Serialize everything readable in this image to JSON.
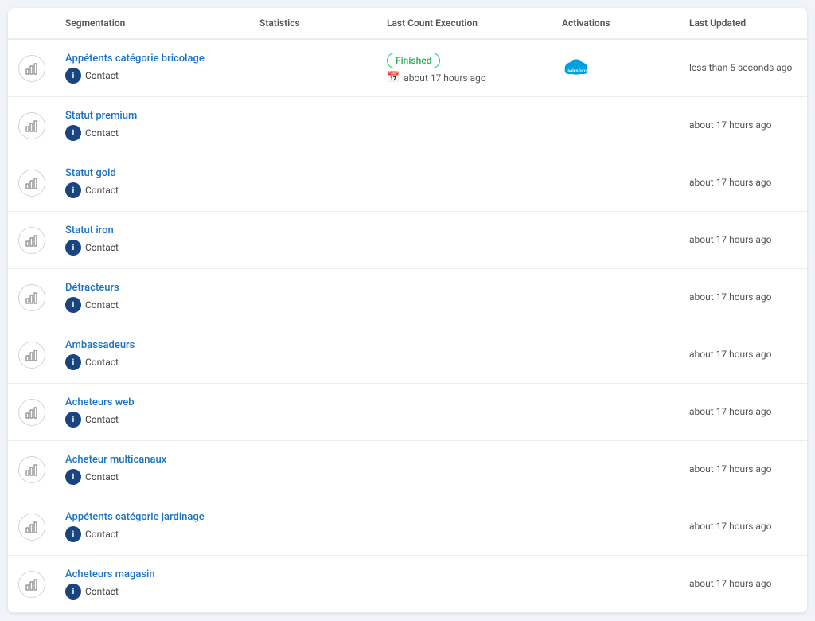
{
  "header": {
    "cols": [
      {
        "key": "icon",
        "label": ""
      },
      {
        "key": "segmentation",
        "label": "Segmentation"
      },
      {
        "key": "statistics",
        "label": "Statistics"
      },
      {
        "key": "last_count",
        "label": "Last Count Execution"
      },
      {
        "key": "activations",
        "label": "Activations"
      },
      {
        "key": "last_updated",
        "label": "Last Updated"
      }
    ]
  },
  "rows": [
    {
      "id": "1",
      "name": "Appétents catégorie bricolage",
      "type": "Contact",
      "status": "Finished",
      "last_count": "about 17 hours ago",
      "has_salesforce": true,
      "last_updated": "less than 5 seconds ago"
    },
    {
      "id": "2",
      "name": "Statut premium",
      "type": "Contact",
      "status": "",
      "last_count": "",
      "has_salesforce": false,
      "last_updated": "about 17 hours ago"
    },
    {
      "id": "3",
      "name": "Statut gold",
      "type": "Contact",
      "status": "",
      "last_count": "",
      "has_salesforce": false,
      "last_updated": "about 17 hours ago"
    },
    {
      "id": "4",
      "name": "Statut iron",
      "type": "Contact",
      "status": "",
      "last_count": "",
      "has_salesforce": false,
      "last_updated": "about 17 hours ago"
    },
    {
      "id": "5",
      "name": "Détracteurs",
      "type": "Contact",
      "status": "",
      "last_count": "",
      "has_salesforce": false,
      "last_updated": "about 17 hours ago"
    },
    {
      "id": "6",
      "name": "Ambassadeurs",
      "type": "Contact",
      "status": "",
      "last_count": "",
      "has_salesforce": false,
      "last_updated": "about 17 hours ago"
    },
    {
      "id": "7",
      "name": "Acheteurs web",
      "type": "Contact",
      "status": "",
      "last_count": "",
      "has_salesforce": false,
      "last_updated": "about 17 hours ago"
    },
    {
      "id": "8",
      "name": "Acheteur multicanaux",
      "type": "Contact",
      "status": "",
      "last_count": "",
      "has_salesforce": false,
      "last_updated": "about 17 hours ago"
    },
    {
      "id": "9",
      "name": "Appétents catégorie jardinage",
      "type": "Contact",
      "status": "",
      "last_count": "",
      "has_salesforce": false,
      "last_updated": "about 17 hours ago"
    },
    {
      "id": "10",
      "name": "Acheteurs magasin",
      "type": "Contact",
      "status": "",
      "last_count": "",
      "has_salesforce": false,
      "last_updated": "about 17 hours ago"
    }
  ],
  "colors": {
    "link": "#1a73c8",
    "badge_border": "#2ecc71",
    "badge_text": "#27ae60",
    "type_icon_bg": "#1a4480"
  }
}
